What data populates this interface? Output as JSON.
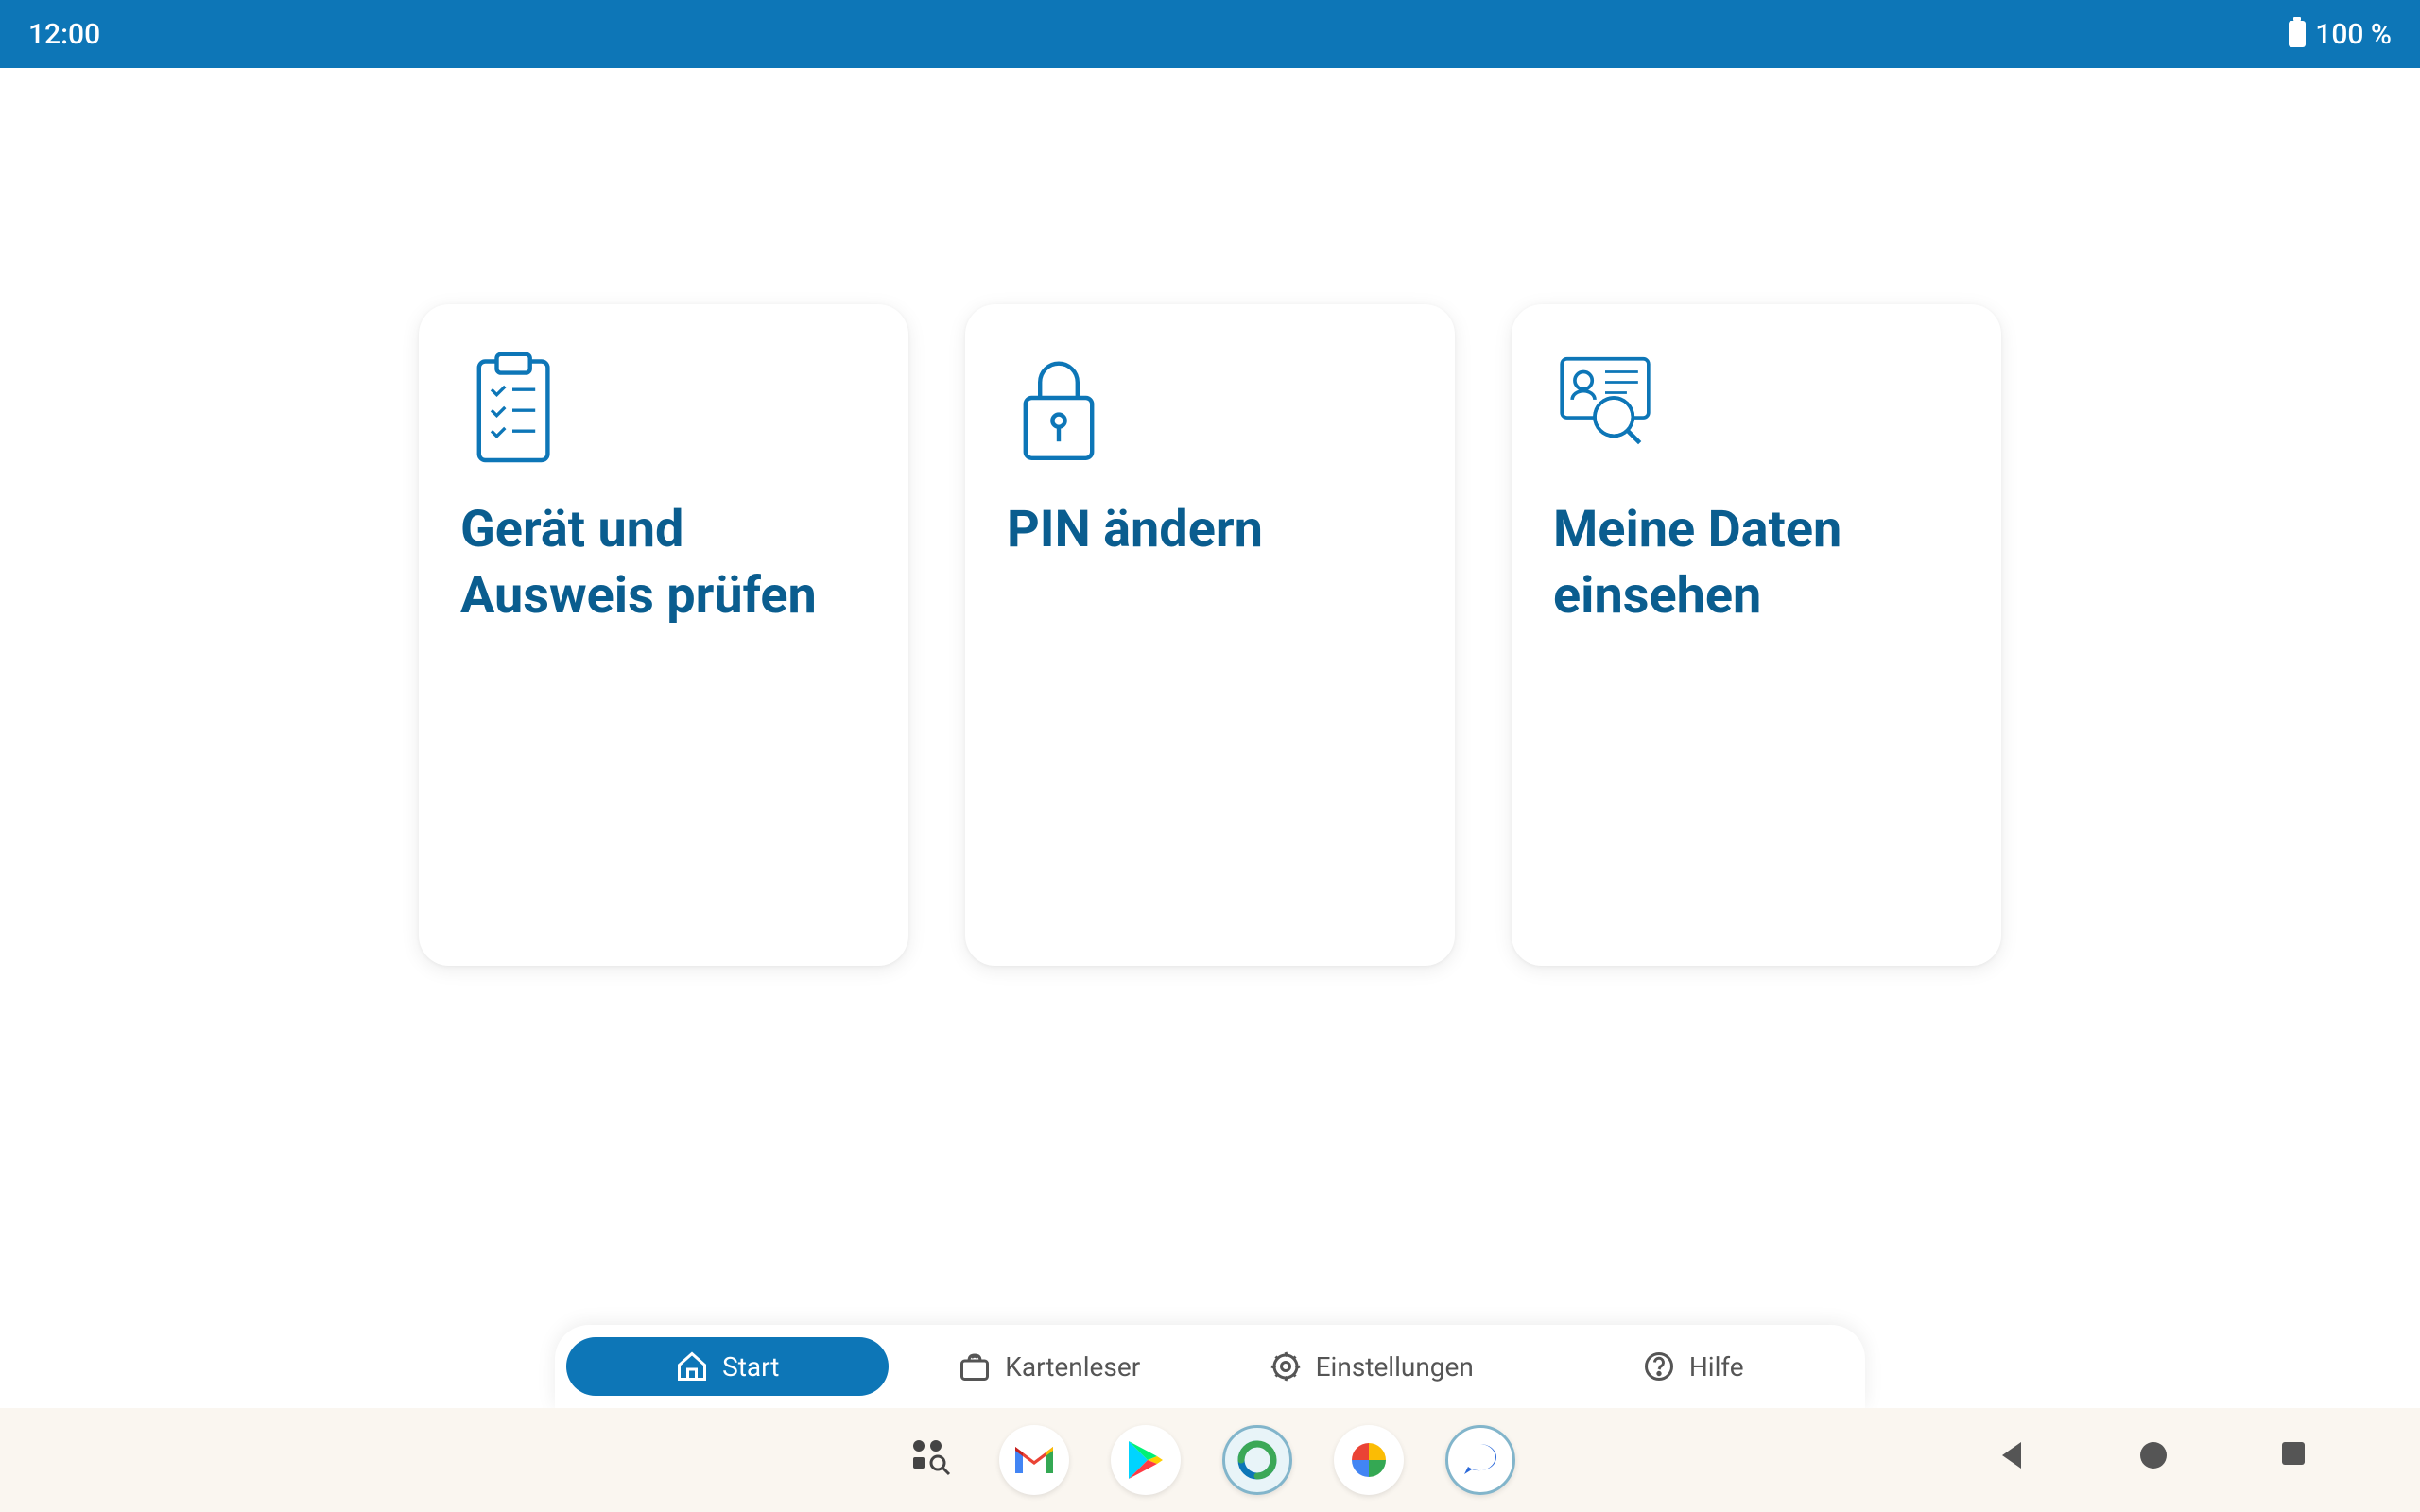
{
  "statusBar": {
    "time": "12:00",
    "batteryPercent": "100 %"
  },
  "cards": [
    {
      "title": "Gerät und Ausweis prüfen",
      "iconName": "checklist-icon"
    },
    {
      "title": "PIN ändern",
      "iconName": "lock-icon"
    },
    {
      "title": "Meine Daten einsehen",
      "iconName": "id-card-icon"
    }
  ],
  "bottomNav": {
    "items": [
      {
        "label": "Start",
        "iconName": "home-icon",
        "active": true
      },
      {
        "label": "Kartenleser",
        "iconName": "card-reader-icon",
        "active": false
      },
      {
        "label": "Einstellungen",
        "iconName": "gear-icon",
        "active": false
      },
      {
        "label": "Hilfe",
        "iconName": "help-icon",
        "active": false
      }
    ]
  },
  "dock": {
    "icons": [
      "app-search",
      "gmail",
      "play-store",
      "ausweis-app",
      "photos",
      "messages"
    ]
  },
  "colors": {
    "primary": "#0d76b7",
    "cardTitle": "#0a5d8f"
  }
}
